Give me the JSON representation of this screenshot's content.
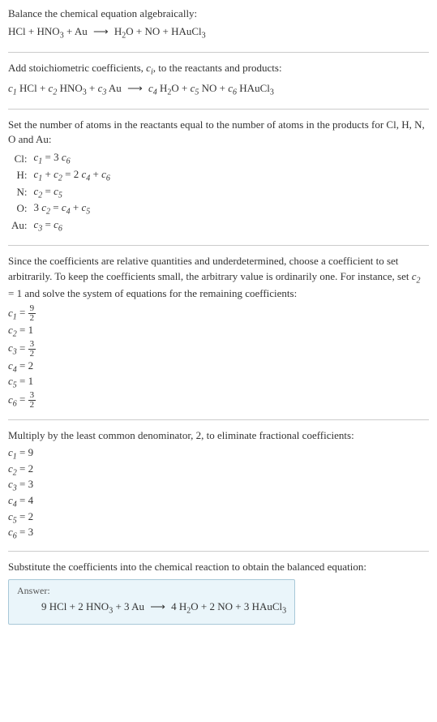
{
  "chart_data": {
    "type": "table",
    "title": "Algebraic balancing of HCl + HNO3 + Au → H2O + NO + HAuCl3",
    "steps": [
      {
        "description": "Balance the chemical equation algebraically:",
        "equation": "HCl + HNO3 + Au → H2O + NO + HAuCl3"
      },
      {
        "description": "Add stoichiometric coefficients c_i to the reactants and products:",
        "equation": "c1 HCl + c2 HNO3 + c3 Au → c4 H2O + c5 NO + c6 HAuCl3"
      },
      {
        "description": "Set the number of atoms in the reactants equal to the number of atoms in the products for Cl, H, N, O and Au:",
        "system": [
          {
            "element": "Cl",
            "equation": "c1 = 3 c6"
          },
          {
            "element": "H",
            "equation": "c1 + c2 = 2 c4 + c6"
          },
          {
            "element": "N",
            "equation": "c2 = c5"
          },
          {
            "element": "O",
            "equation": "3 c2 = c4 + c5"
          },
          {
            "element": "Au",
            "equation": "c3 = c6"
          }
        ]
      },
      {
        "description": "Set c2 = 1 and solve:",
        "solution": {
          "c1": "9/2",
          "c2": "1",
          "c3": "3/2",
          "c4": "2",
          "c5": "1",
          "c6": "3/2"
        }
      },
      {
        "description": "Multiply by the least common denominator, 2:",
        "solution": {
          "c1": 9,
          "c2": 2,
          "c3": 3,
          "c4": 4,
          "c5": 2,
          "c6": 3
        }
      }
    ],
    "balanced_equation": "9 HCl + 2 HNO3 + 3 Au → 4 H2O + 2 NO + 3 HAuCl3"
  },
  "s1": {
    "intro": "Balance the chemical equation algebraically:"
  },
  "s2": {
    "intro_a": "Add stoichiometric coefficients, ",
    "intro_b": ", to the reactants and products:"
  },
  "s3": {
    "intro": "Set the number of atoms in the reactants equal to the number of atoms in the products for Cl, H, N, O and Au:",
    "rows": {
      "cl": "Cl:",
      "h": "H:",
      "n": "N:",
      "o": "O:",
      "au": "Au:"
    }
  },
  "s4": {
    "intro_a": "Since the coefficients are relative quantities and underdetermined, choose a coefficient to set arbitrarily. To keep the coefficients small, the arbitrary value is ordinarily one. For instance, set ",
    "intro_b": " and solve the system of equations for the remaining coefficients:"
  },
  "s5": {
    "intro": "Multiply by the least common denominator, 2, to eliminate fractional coefficients:"
  },
  "s6": {
    "intro": "Substitute the coefficients into the chemical reaction to obtain the balanced equation:"
  },
  "answer": {
    "label": "Answer:"
  },
  "sym": {
    "c": "c",
    "i": "i",
    "eq": " = ",
    "plus": " + ",
    "arrow": "⟶",
    "n1": "1",
    "n2": "2",
    "n3": "3",
    "n4": "4",
    "n5": "5",
    "n6": "6",
    "n9": "9"
  },
  "chem": {
    "HCl": "HCl",
    "HNO": "HNO",
    "Au": "Au",
    "H": "H",
    "O": "O",
    "NO": "NO",
    "HAuCl": "HAuCl"
  },
  "eqs": {
    "cl_rhs_a": " = 3 ",
    "h_mid": " = 2 ",
    "o_mid": "3 "
  }
}
